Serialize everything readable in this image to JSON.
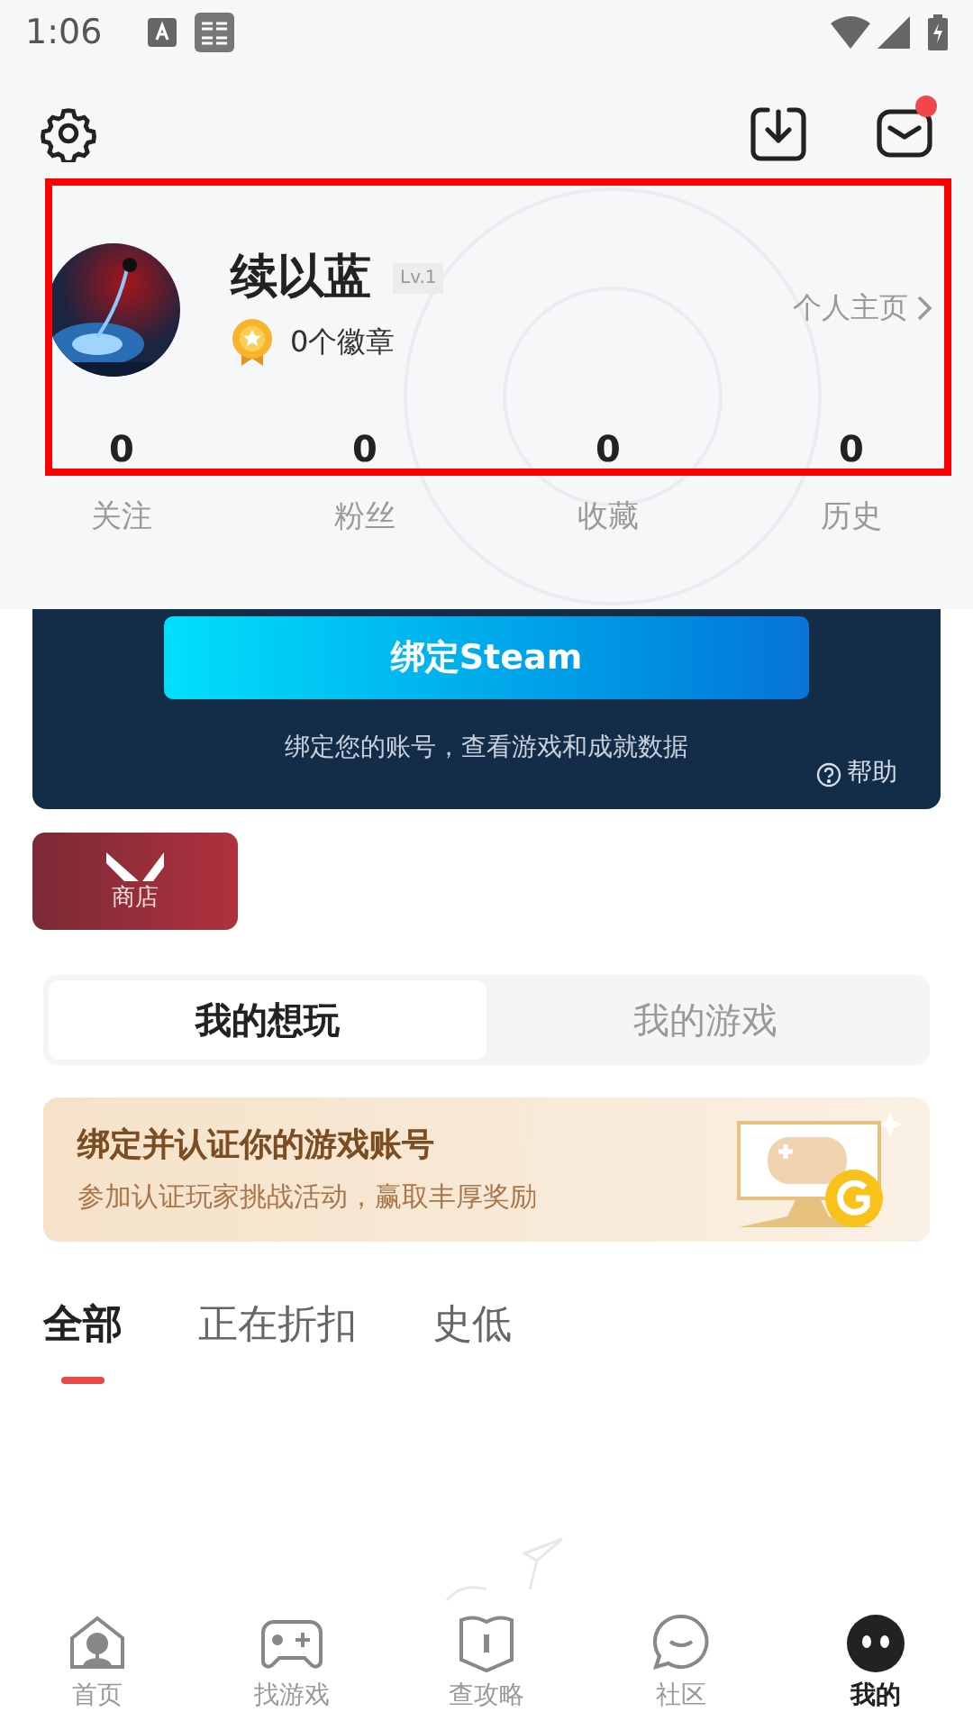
{
  "status_bar": {
    "time": "1:06"
  },
  "header": {
    "has_unread_messages": true
  },
  "profile": {
    "name": "续以蓝",
    "level": "Lv.1",
    "badges": "0个徽章",
    "homepage_link": "个人主页"
  },
  "stats": [
    {
      "value": "0",
      "label": "关注"
    },
    {
      "value": "0",
      "label": "粉丝"
    },
    {
      "value": "0",
      "label": "收藏"
    },
    {
      "value": "0",
      "label": "历史"
    }
  ],
  "steam_card": {
    "button": "绑定Steam",
    "description": "绑定您的账号，查看游戏和成就数据",
    "help": "帮助"
  },
  "shop_tile": {
    "label": "商店"
  },
  "segment_tabs": [
    {
      "label": "我的想玩",
      "selected": true
    },
    {
      "label": "我的游戏",
      "selected": false
    }
  ],
  "promo_banner": {
    "title": "绑定并认证你的游戏账号",
    "subtitle": "参加认证玩家挑战活动，赢取丰厚奖励"
  },
  "filter_tabs": [
    {
      "label": "全部",
      "selected": true
    },
    {
      "label": "正在折扣",
      "selected": false
    },
    {
      "label": "史低",
      "selected": false
    }
  ],
  "bottom_nav": [
    {
      "label": "首页",
      "selected": false
    },
    {
      "label": "找游戏",
      "selected": false
    },
    {
      "label": "查攻略",
      "selected": false
    },
    {
      "label": "社区",
      "selected": false
    },
    {
      "label": "我的",
      "selected": true
    }
  ]
}
